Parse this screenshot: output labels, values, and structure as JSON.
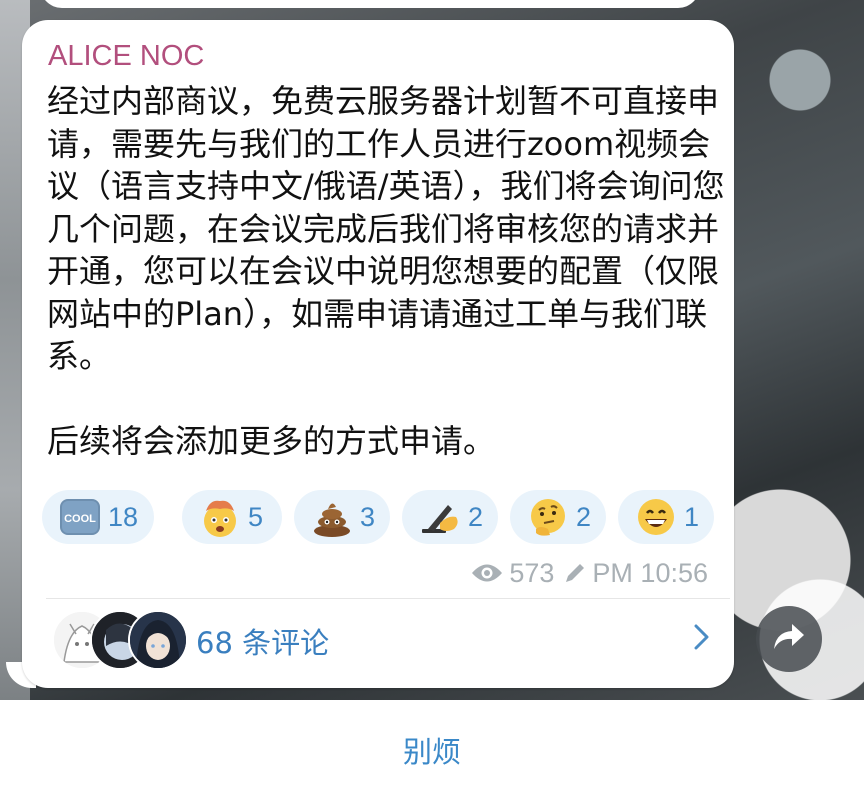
{
  "channel_post": {
    "sender": "ALICE NOC",
    "message": "经过内部商议，免费云服务器计划暂不可直接申请，需要先与我们的工作人员进行zoom视频会议（语言支持中文/俄语/英语），我们将会询问您几个问题，在会议完成后我们将审核您的请求并开通，您可以在会议中说明您想要的配置（仅限网站中的Plan），如需申请请通过工单与我们联系。\n\n后续将会添加更多的方式申请。",
    "reactions": [
      {
        "icon": "cool-emoji",
        "count": "18"
      },
      {
        "icon": "exploding-head-emoji",
        "count": "5"
      },
      {
        "icon": "poop-emoji",
        "count": "3"
      },
      {
        "icon": "writing-hand-emoji",
        "count": "2"
      },
      {
        "icon": "thinking-face-emoji",
        "count": "2"
      },
      {
        "icon": "grinning-face-emoji",
        "count": "1"
      }
    ],
    "views": "573",
    "time": "PM 10:56",
    "comments_label": "68 条评论"
  },
  "footer": {
    "mute_label": "别烦"
  },
  "colors": {
    "sender": "#b24f7d",
    "link": "#3a88c8",
    "reaction_bg": "#e9f3fb"
  }
}
